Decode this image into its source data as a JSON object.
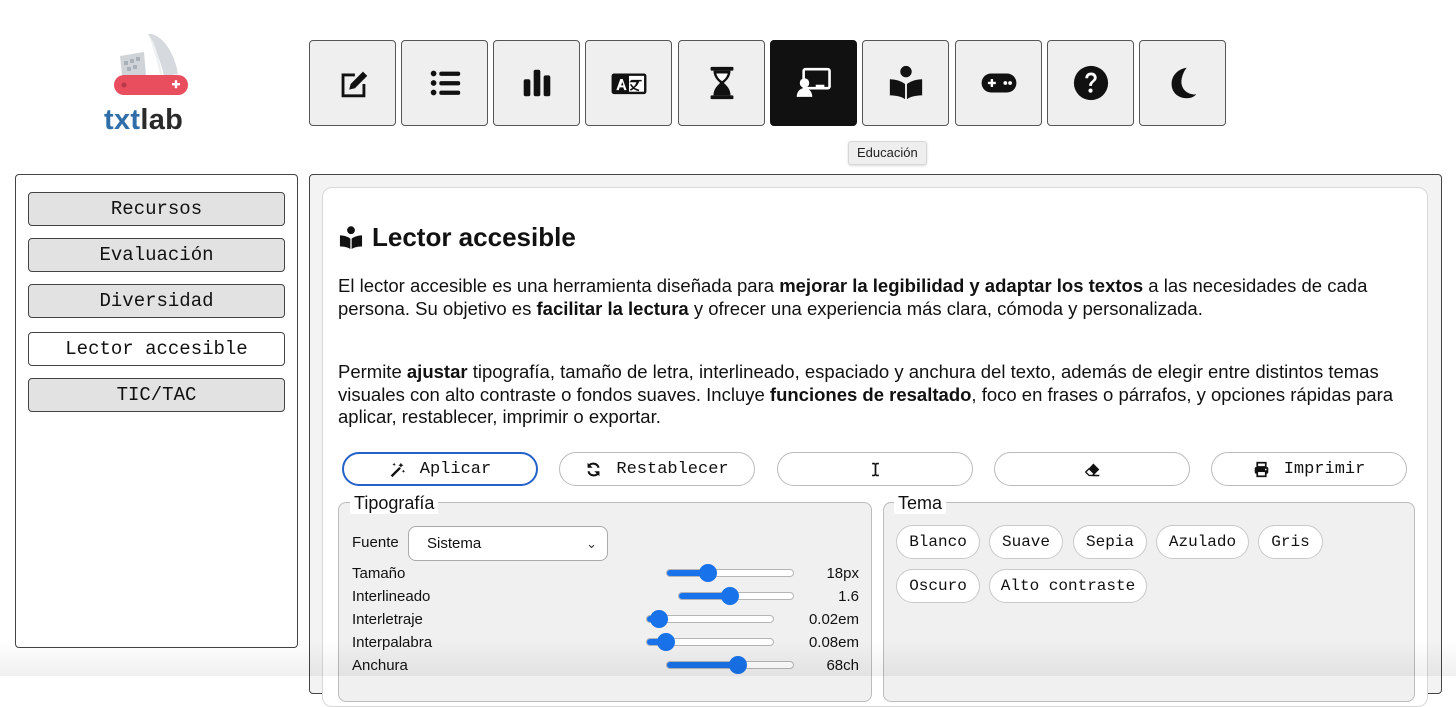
{
  "logo": {
    "part1": "txt",
    "part2": "lab",
    "icon": "swiss-knife-icon"
  },
  "toolbar": {
    "buttons": [
      {
        "icon": "edit-icon"
      },
      {
        "icon": "list-icon"
      },
      {
        "icon": "bar-chart-icon"
      },
      {
        "icon": "translate-icon"
      },
      {
        "icon": "hourglass-icon"
      },
      {
        "icon": "chalkboard-teacher-icon",
        "active": true
      },
      {
        "icon": "book-reader-icon"
      },
      {
        "icon": "gamepad-icon"
      },
      {
        "icon": "question-icon"
      },
      {
        "icon": "moon-icon"
      }
    ],
    "tooltip": "Educación"
  },
  "sidebar": {
    "items": [
      {
        "label": "Recursos"
      },
      {
        "label": "Evaluación"
      },
      {
        "label": "Diversidad"
      },
      {
        "label": "Lector accesible",
        "active": true
      },
      {
        "label": "TIC/TAC"
      }
    ]
  },
  "main": {
    "title": "Lector accesible",
    "para1": {
      "t1": "El lector accesible es una herramienta diseñada para ",
      "b1": "mejorar la legibilidad y adaptar los textos",
      "t2": " a las necesidades de cada persona. Su objetivo es ",
      "b2": "facilitar la lectura",
      "t3": " y ofrecer una experiencia más clara, cómoda y personalizada."
    },
    "para2": {
      "t1": "Permite ",
      "b1": "ajustar",
      "t2": " tipografía, tamaño de letra, interlineado, espaciado y anchura del texto, además de elegir entre distintos temas visuales con alto contraste o fondos suaves. Incluye ",
      "b2": "funciones de resaltado",
      "t3": ", foco en frases o párrafos, y opciones rápidas para aplicar, restablecer, imprimir o exportar."
    },
    "actions": {
      "apply": "Aplicar",
      "reset": "Restablecer",
      "print": "Imprimir"
    },
    "typography": {
      "legend": "Tipografía",
      "font_label": "Fuente",
      "font_value": "Sistema",
      "sliders": [
        {
          "label": "Tamaño",
          "value": "18px",
          "level": 0.33
        },
        {
          "label": "Interlineado",
          "value": "1.6",
          "level": 0.45
        },
        {
          "label": "Interletraje",
          "value": "0.02em",
          "level": 0.1
        },
        {
          "label": "Interpalabra",
          "value": "0.08em",
          "level": 0.16
        },
        {
          "label": "Anchura",
          "value": "68ch",
          "level": 0.56
        }
      ]
    },
    "theme": {
      "legend": "Tema",
      "options": [
        "Blanco",
        "Suave",
        "Sepia",
        "Azulado",
        "Gris",
        "Oscuro",
        "Alto contraste"
      ]
    }
  },
  "colors": {
    "accent": "#1872ea",
    "primary_border": "#2262c9",
    "logo_blue": "#2f6ea8",
    "logo_red": "#e94e5f"
  }
}
